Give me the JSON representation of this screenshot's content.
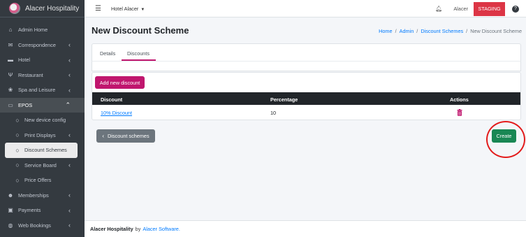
{
  "brand": {
    "name": "Alacer Hospitality"
  },
  "topbar": {
    "hotel": "Hotel Alacer",
    "user": "Alacer",
    "env_badge": "STAGING"
  },
  "sidebar": {
    "items": [
      {
        "label": "Admin Home",
        "icon": "home-icon"
      },
      {
        "label": "Correspondence",
        "icon": "envelope-icon"
      },
      {
        "label": "Hotel",
        "icon": "bed-icon"
      },
      {
        "label": "Restaurant",
        "icon": "utensils-icon"
      },
      {
        "label": "Spa and Leisure",
        "icon": "spa-icon"
      },
      {
        "label": "EPOS",
        "icon": "credit-card-icon"
      },
      {
        "label": "New device config",
        "icon": "circle-icon"
      },
      {
        "label": "Print Displays",
        "icon": "circle-icon"
      },
      {
        "label": "Discount Schemes",
        "icon": "circle-icon"
      },
      {
        "label": "Service Board",
        "icon": "circle-icon"
      },
      {
        "label": "Price Offers",
        "icon": "circle-icon"
      },
      {
        "label": "Memberships",
        "icon": "users-icon"
      },
      {
        "label": "Payments",
        "icon": "money-icon"
      },
      {
        "label": "Web Bookings",
        "icon": "globe-icon"
      }
    ]
  },
  "page": {
    "title": "New Discount Scheme",
    "breadcrumb": {
      "home": "Home",
      "admin": "Admin",
      "schemes": "Discount Schemes",
      "current": "New Discount Scheme"
    },
    "tabs": {
      "details": "Details",
      "discounts": "Discounts"
    },
    "add_button": "Add new discount",
    "table": {
      "headers": {
        "discount": "Discount",
        "percentage": "Percentage",
        "actions": "Actions"
      },
      "rows": [
        {
          "discount": "10% Discount",
          "percentage": "10"
        }
      ]
    },
    "back_button": "Discount schemes",
    "create_button": "Create"
  },
  "footer": {
    "company": "Alacer Hospitality",
    "by": "by",
    "vendor": "Alacer Software."
  },
  "colors": {
    "accent": "#c0166e",
    "create": "#198754",
    "staging": "#dc3545",
    "sidebar": "#343a40"
  }
}
